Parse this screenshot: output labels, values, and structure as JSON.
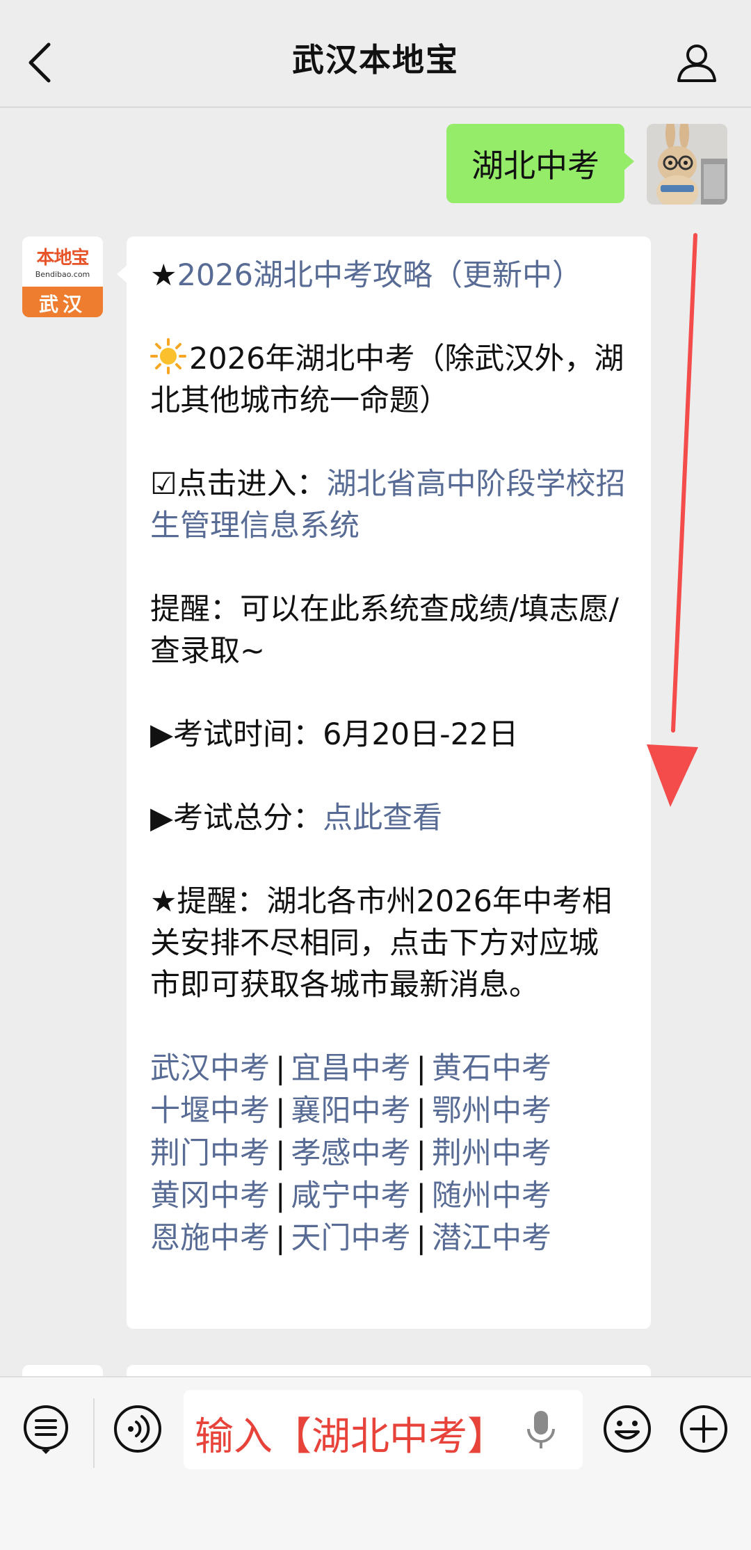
{
  "header": {
    "title": "武汉本地宝"
  },
  "chat": {
    "outgoing": "湖北中考",
    "bot_avatar": {
      "logo_text": "本地宝",
      "domain": "Bendibao.com",
      "city": "武汉"
    },
    "reply": {
      "line1_prefix": "★",
      "line1_link": "2026湖北中考攻略（更新中）",
      "line2": "2026年湖北中考（除武汉外，湖北其他城市统一命题）",
      "line3_prefix": "☑点击进入：",
      "line3_link": "湖北省高中阶段学校招生管理信息系统",
      "line4": "提醒：可以在此系统查成绩/填志愿/查录取~",
      "line5": "▶考试时间：6月20日-22日",
      "line6_prefix": "▶考试总分：",
      "line6_link": "点此查看",
      "line7": "★提醒：湖北各市州2026年中考相关安排不尽相同，点击下方对应城市即可获取各城市最新消息。",
      "sep": "|",
      "cities": [
        [
          "武汉中考",
          "宜昌中考",
          "黄石中考"
        ],
        [
          "十堰中考",
          "襄阳中考",
          "鄂州中考"
        ],
        [
          "荆门中考",
          "孝感中考",
          "荆州中考"
        ],
        [
          "黄冈中考",
          "咸宁中考",
          "随州中考"
        ],
        [
          "恩施中考",
          "天门中考",
          "潜江中考"
        ]
      ]
    }
  },
  "input": {
    "text": "输入【湖北中考】"
  },
  "icons": {
    "back": "chevron-left-icon",
    "profile": "person-icon",
    "menu": "list-menu-icon",
    "voice": "voice-icon",
    "mic": "mic-icon",
    "emoji": "emoji-icon",
    "plus": "plus-icon"
  },
  "colors": {
    "link": "#576b95",
    "bubble_out": "#95ec69",
    "arrow": "#f44b4b",
    "input_text": "#e8433a"
  }
}
